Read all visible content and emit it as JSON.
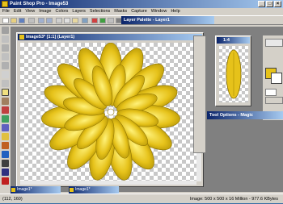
{
  "app": {
    "title": "Paint Shop Pro - Image53"
  },
  "menu": [
    "File",
    "Edit",
    "View",
    "Image",
    "Colors",
    "Layers",
    "Selections",
    "Masks",
    "Capture",
    "Window",
    "Help"
  ],
  "document": {
    "title": "Image53* [1:1] (Layer1)"
  },
  "layer_palette": {
    "title": "Layer Palette - Layer1"
  },
  "preview": {
    "title": "1:4"
  },
  "tool_options": {
    "title": "Tool Options - Magic"
  },
  "minimized": [
    {
      "label": "Image1*"
    },
    {
      "label": "Image1*"
    }
  ],
  "status": {
    "coords": "(112, 160)",
    "image_info": "Image: 500 x 500 x 16 Million - 977.6 KBytes"
  },
  "colors": {
    "flower": "#e6c21a",
    "flower_shadow": "#a88a00",
    "accent": "#0a246a"
  }
}
